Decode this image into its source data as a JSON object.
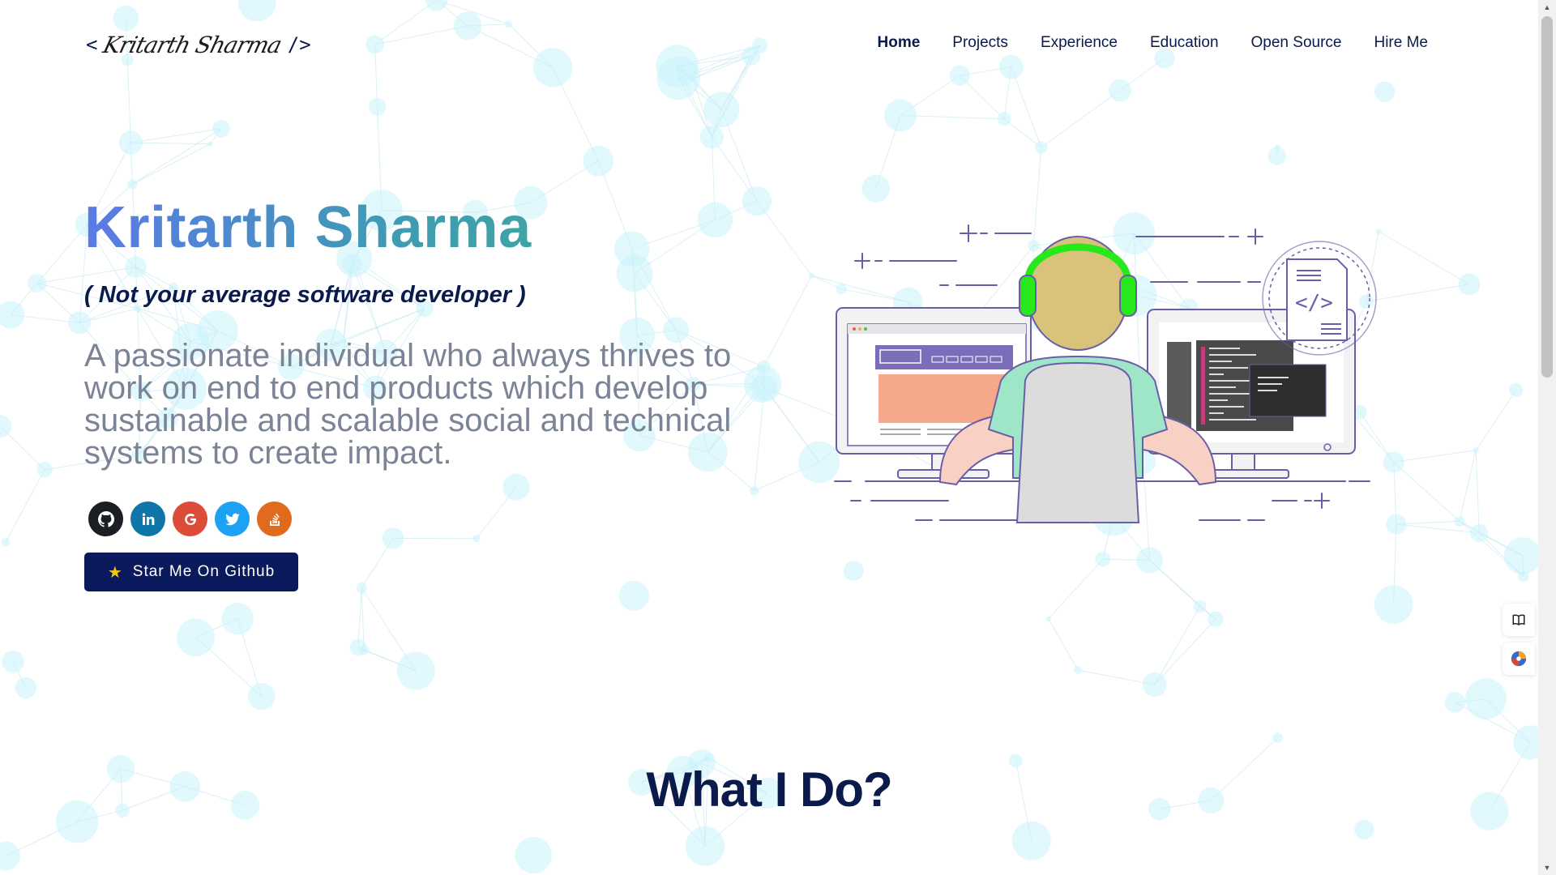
{
  "logo": {
    "open": "<",
    "name": "Kritarth Sharma",
    "close": "/>"
  },
  "nav": {
    "items": [
      {
        "label": "Home",
        "active": true
      },
      {
        "label": "Projects"
      },
      {
        "label": "Experience"
      },
      {
        "label": "Education"
      },
      {
        "label": "Open Source"
      },
      {
        "label": "Hire Me"
      }
    ]
  },
  "hero": {
    "name": "Kritarth Sharma",
    "tagline": "( Not your average software developer )",
    "description": "A passionate individual who always thrives to work on end to end products which develop sustainable and scalable social and technical systems to create impact.",
    "social": [
      {
        "name": "github-icon",
        "color": "#1b1f23"
      },
      {
        "name": "linkedin-icon",
        "color": "#0e76a8"
      },
      {
        "name": "google-icon",
        "color": "#dd4b39"
      },
      {
        "name": "twitter-icon",
        "color": "#1da1f2"
      },
      {
        "name": "stackoverflow-icon",
        "color": "#e06b1f"
      }
    ],
    "cta_label": "Star Me On Github"
  },
  "section": {
    "title": "What I Do?"
  },
  "colors": {
    "primary": "#0a1a4a",
    "button": "#0a1a5c",
    "gradient_start": "#5b79e6",
    "gradient_end": "#3fb08e",
    "description": "#7b8397",
    "particles": "#c8f3fb"
  }
}
